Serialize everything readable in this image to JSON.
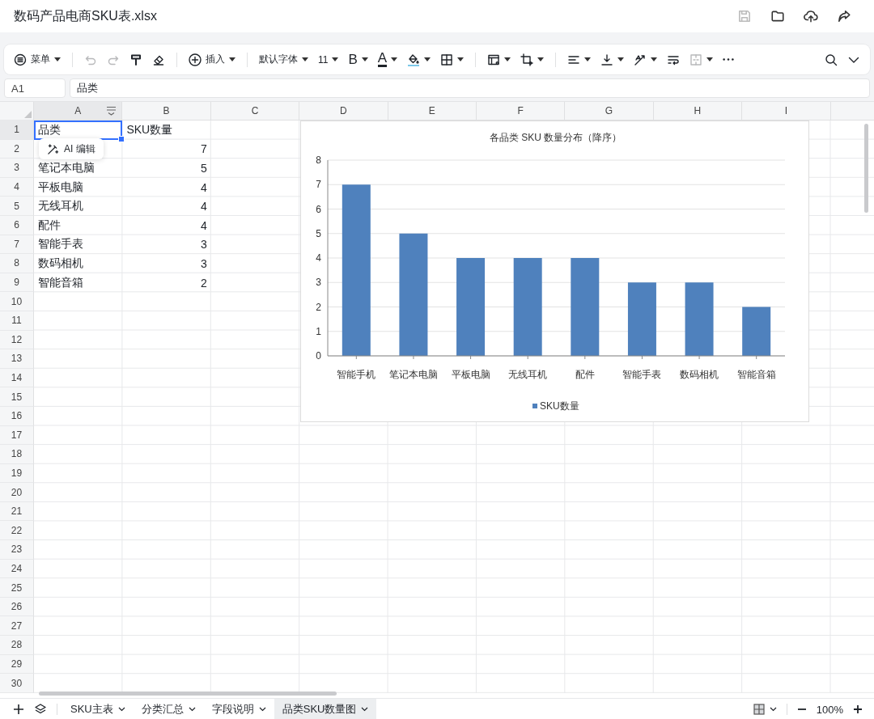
{
  "window": {
    "title": "数码产品电商SKU表.xlsx",
    "actions": [
      {
        "kind": "save",
        "disabled": true
      },
      {
        "kind": "folder",
        "disabled": false
      },
      {
        "kind": "upload",
        "disabled": false
      },
      {
        "kind": "share",
        "disabled": false
      }
    ]
  },
  "toolbar": {
    "items": [
      {
        "kind": "menu",
        "label": "菜单",
        "dropdown": true,
        "disabled": false
      },
      {
        "kind": "separator"
      },
      {
        "kind": "undo",
        "dropdown": false,
        "disabled": true
      },
      {
        "kind": "redo",
        "dropdown": false,
        "disabled": true
      },
      {
        "kind": "painter",
        "dropdown": false,
        "disabled": false
      },
      {
        "kind": "eraser",
        "dropdown": false,
        "disabled": false
      },
      {
        "kind": "separator"
      },
      {
        "kind": "insert",
        "label": "插入",
        "dropdown": true,
        "disabled": false
      },
      {
        "kind": "separator"
      },
      {
        "kind": "font",
        "label": "默认字体",
        "dropdown": true,
        "disabled": false
      },
      {
        "kind": "size",
        "label": "11",
        "dropdown": true,
        "disabled": false
      },
      {
        "kind": "bold",
        "label": "B",
        "dropdown": true,
        "disabled": false
      },
      {
        "kind": "color",
        "label": "A",
        "dropdown": true,
        "disabled": false
      },
      {
        "kind": "fill",
        "dropdown": true,
        "disabled": false
      },
      {
        "kind": "border",
        "dropdown": true,
        "disabled": false
      },
      {
        "kind": "separator"
      },
      {
        "kind": "table",
        "dropdown": true,
        "disabled": false
      },
      {
        "kind": "crop",
        "dropdown": true,
        "disabled": false
      },
      {
        "kind": "separator"
      },
      {
        "kind": "align",
        "dropdown": true,
        "disabled": false
      },
      {
        "kind": "valign",
        "dropdown": true,
        "disabled": false
      },
      {
        "kind": "rotate",
        "dropdown": true,
        "disabled": false
      },
      {
        "kind": "wrap",
        "dropdown": false,
        "disabled": false
      },
      {
        "kind": "merge",
        "dropdown": true,
        "disabled": true
      },
      {
        "kind": "more",
        "dropdown": false,
        "disabled": false
      }
    ],
    "right": [
      {
        "kind": "search",
        "dropdown": false,
        "disabled": false
      },
      {
        "kind": "collapse",
        "dropdown": false,
        "disabled": false
      }
    ]
  },
  "formula_bar": {
    "cell_ref": "A1",
    "value": "品类"
  },
  "columns": [
    {
      "label": "A",
      "selected": true
    },
    {
      "label": "B",
      "selected": false
    },
    {
      "label": "C",
      "selected": false
    },
    {
      "label": "D",
      "selected": false
    },
    {
      "label": "E",
      "selected": false
    },
    {
      "label": "F",
      "selected": false
    },
    {
      "label": "G",
      "selected": false
    },
    {
      "label": "H",
      "selected": false
    },
    {
      "label": "I",
      "selected": false
    }
  ],
  "rows": [
    {
      "number": "1",
      "selected": true,
      "cells": [
        {
          "text": "品类",
          "kind": "text",
          "selected": true
        },
        {
          "text": "SKU数量",
          "kind": "text",
          "selected": false
        }
      ]
    },
    {
      "number": "2",
      "selected": false,
      "cells": [
        null,
        {
          "text": "7",
          "kind": "number",
          "selected": false
        }
      ]
    },
    {
      "number": "3",
      "selected": false,
      "cells": [
        {
          "text": "笔记本电脑",
          "kind": "text",
          "selected": false
        },
        {
          "text": "5",
          "kind": "number",
          "selected": false
        }
      ]
    },
    {
      "number": "4",
      "selected": false,
      "cells": [
        {
          "text": "平板电脑",
          "kind": "text",
          "selected": false
        },
        {
          "text": "4",
          "kind": "number",
          "selected": false
        }
      ]
    },
    {
      "number": "5",
      "selected": false,
      "cells": [
        {
          "text": "无线耳机",
          "kind": "text",
          "selected": false
        },
        {
          "text": "4",
          "kind": "number",
          "selected": false
        }
      ]
    },
    {
      "number": "6",
      "selected": false,
      "cells": [
        {
          "text": "配件",
          "kind": "text",
          "selected": false
        },
        {
          "text": "4",
          "kind": "number",
          "selected": false
        }
      ]
    },
    {
      "number": "7",
      "selected": false,
      "cells": [
        {
          "text": "智能手表",
          "kind": "text",
          "selected": false
        },
        {
          "text": "3",
          "kind": "number",
          "selected": false
        }
      ]
    },
    {
      "number": "8",
      "selected": false,
      "cells": [
        {
          "text": "数码相机",
          "kind": "text",
          "selected": false
        },
        {
          "text": "3",
          "kind": "number",
          "selected": false
        }
      ]
    },
    {
      "number": "9",
      "selected": false,
      "cells": [
        {
          "text": "智能音箱",
          "kind": "text",
          "selected": false
        },
        {
          "text": "2",
          "kind": "number",
          "selected": false
        }
      ]
    },
    {
      "number": "10",
      "selected": false
    },
    {
      "number": "11",
      "selected": false
    },
    {
      "number": "12",
      "selected": false
    },
    {
      "number": "13",
      "selected": false
    },
    {
      "number": "14",
      "selected": false
    },
    {
      "number": "15",
      "selected": false
    },
    {
      "number": "16",
      "selected": false
    },
    {
      "number": "17",
      "selected": false
    },
    {
      "number": "18",
      "selected": false
    },
    {
      "number": "19",
      "selected": false
    },
    {
      "number": "20",
      "selected": false
    },
    {
      "number": "21",
      "selected": false
    },
    {
      "number": "22",
      "selected": false
    },
    {
      "number": "23",
      "selected": false
    },
    {
      "number": "24",
      "selected": false
    },
    {
      "number": "25",
      "selected": false
    },
    {
      "number": "26",
      "selected": false
    },
    {
      "number": "27",
      "selected": false
    },
    {
      "number": "28",
      "selected": false
    },
    {
      "number": "29",
      "selected": false
    },
    {
      "number": "30",
      "selected": false
    }
  ],
  "ai_popup": {
    "label": "AI 编辑"
  },
  "chart": {
    "chart_data": {
      "type": "bar",
      "title": "各品类 SKU 数量分布（降序）",
      "categories": [
        "智能手机",
        "笔记本电脑",
        "平板电脑",
        "无线耳机",
        "配件",
        "智能手表",
        "数码相机",
        "智能音箱"
      ],
      "series": [
        {
          "name": "SKU数量",
          "color": "#4f81bd",
          "values": [
            7,
            5,
            4,
            4,
            4,
            3,
            3,
            2
          ]
        }
      ],
      "ylim": [
        0,
        8
      ],
      "yticks": [
        0,
        1,
        2,
        3,
        4,
        5,
        6,
        7,
        8
      ],
      "grid": true
    }
  },
  "sheet_tabs": [
    {
      "label": "SKU主表",
      "selected": false
    },
    {
      "label": "分类汇总",
      "selected": false
    },
    {
      "label": "字段说明",
      "selected": false
    },
    {
      "label": "品类SKU数量图",
      "selected": true
    }
  ],
  "zoom": {
    "value": "100%"
  }
}
